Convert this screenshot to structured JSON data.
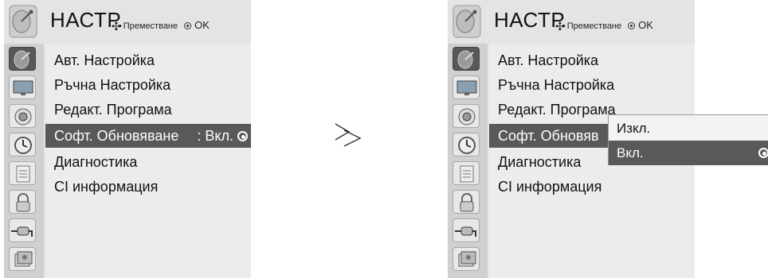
{
  "left_panel": {
    "title": "НАСТР.",
    "hint_move": "Преместване",
    "hint_ok": "OK",
    "selected_icon": "settings-satellite-icon",
    "items": [
      {
        "label": "Авт. Настройка"
      },
      {
        "label": "Ръчна Настройка"
      },
      {
        "label": "Редакт. Програма"
      },
      {
        "label": "Софт. Обновяване",
        "value": ": Вкл."
      },
      {
        "label": "Диагностика"
      },
      {
        "label": "CI информация"
      }
    ]
  },
  "right_panel": {
    "title": "НАСТР.",
    "hint_move": "Преместване",
    "hint_ok": "OK",
    "items": [
      {
        "label": "Авт. Настройка"
      },
      {
        "label": "Ръчна Настройка"
      },
      {
        "label": "Редакт. Програма"
      },
      {
        "label": "Софт. Обновяв"
      },
      {
        "label": "Диагностика"
      },
      {
        "label": "CI информация"
      }
    ],
    "popup_options": [
      {
        "label": "Изкл."
      },
      {
        "label": "Вкл."
      }
    ]
  },
  "arrow_symbol": "≫",
  "sidebar_icons": [
    "satellite-icon",
    "picture-icon",
    "audio-icon",
    "time-icon",
    "option-icon",
    "lock-icon",
    "input-icon",
    "media-icon"
  ],
  "colors": {
    "selection": "#595959",
    "panel": "#e4e4e4",
    "sidebar": "#d0d0d0"
  }
}
